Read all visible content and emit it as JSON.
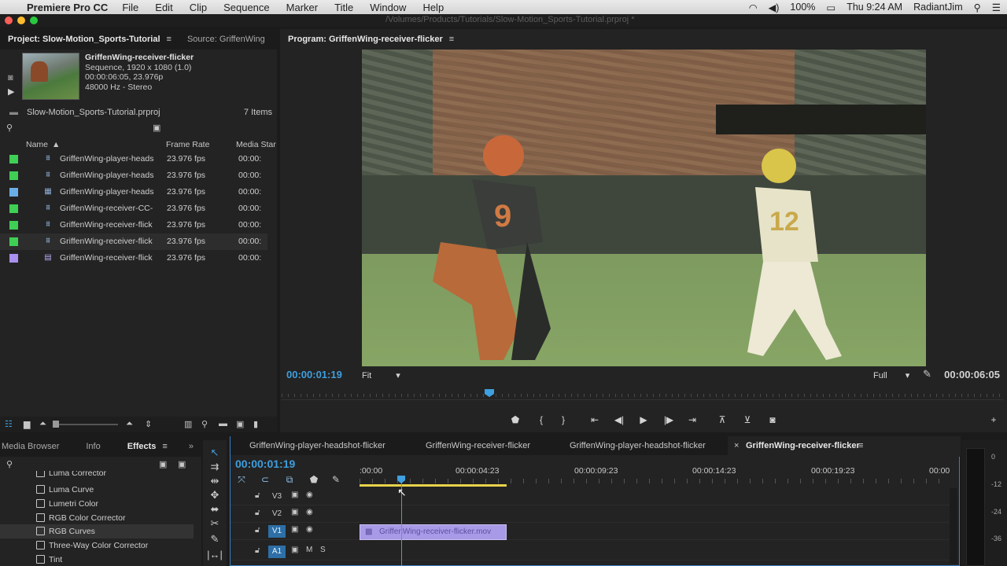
{
  "menubar": {
    "app_name": "Premiere Pro CC",
    "items": [
      "File",
      "Edit",
      "Clip",
      "Sequence",
      "Marker",
      "Title",
      "Window",
      "Help"
    ],
    "battery": "100%",
    "clock": "Thu 9:24 AM",
    "user": "RadiantJim"
  },
  "window": {
    "title_path": "/Volumes/Products/Tutorials/Slow-Motion_Sports-Tutorial.prproj *"
  },
  "project": {
    "tab_label": "Project: Slow-Motion_Sports-Tutorial",
    "source_tab_label": "Source: GriffenWing",
    "preview": {
      "name": "GriffenWing-receiver-flicker",
      "line1": "Sequence, 1920 x 1080 (1.0)",
      "line2": "00:00:06:05, 23.976p",
      "line3": "48000 Hz - Stereo"
    },
    "project_file": "Slow-Motion_Sports-Tutorial.prproj",
    "item_count": "7 Items",
    "columns": {
      "name": "Name",
      "frame_rate": "Frame Rate",
      "media_start": "Media Star"
    },
    "files": [
      {
        "name": "GriffenWing-player-heads",
        "fps": "23.976 fps",
        "start": "00:00:",
        "color": "#3fcf55",
        "icon": "sequence"
      },
      {
        "name": "GriffenWing-player-heads",
        "fps": "23.976 fps",
        "start": "00:00:",
        "color": "#3fcf55",
        "icon": "sequence"
      },
      {
        "name": "GriffenWing-player-heads",
        "fps": "23.976 fps",
        "start": "00:00:",
        "color": "#6aaee8",
        "icon": "clip"
      },
      {
        "name": "GriffenWing-receiver-CC-",
        "fps": "23.976 fps",
        "start": "00:00:",
        "color": "#3fcf55",
        "icon": "sequence"
      },
      {
        "name": "GriffenWing-receiver-flick",
        "fps": "23.976 fps",
        "start": "00:00:",
        "color": "#3fcf55",
        "icon": "sequence"
      },
      {
        "name": "GriffenWing-receiver-flick",
        "fps": "23.976 fps",
        "start": "00:00:",
        "color": "#3fcf55",
        "icon": "sequence"
      },
      {
        "name": "GriffenWing-receiver-flick",
        "fps": "23.976 fps",
        "start": "00:00:",
        "color": "#a98ff0",
        "icon": "film"
      }
    ]
  },
  "program": {
    "tab_label": "Program: GriffenWing-receiver-flicker",
    "current_tc": "00:00:01:19",
    "fit_label": "Fit",
    "quality_label": "Full",
    "duration_tc": "00:00:06:05"
  },
  "effects_panel": {
    "tabs": [
      "Media Browser",
      "Info",
      "Effects"
    ],
    "items": [
      "Luma Corrector",
      "Luma Curve",
      "Lumetri Color",
      "RGB Color Corrector",
      "RGB Curves",
      "Three-Way Color Corrector",
      "Tint"
    ],
    "selected_index": 4
  },
  "timeline": {
    "tabs": [
      "GriffenWing-player-headshot-flicker",
      "GriffenWing-receiver-flicker",
      "GriffenWing-player-headshot-flicker",
      "GriffenWing-receiver-flicker"
    ],
    "active_tab_index": 3,
    "current_tc": "00:00:01:19",
    "ruler": [
      ":00:00",
      "00:00:04:23",
      "00:00:09:23",
      "00:00:14:23",
      "00:00:19:23",
      "00:00"
    ],
    "tracks": [
      {
        "name": "V3",
        "kind": "video",
        "targeted": false
      },
      {
        "name": "V2",
        "kind": "video",
        "targeted": false
      },
      {
        "name": "V1",
        "kind": "video",
        "targeted": true
      },
      {
        "name": "A1",
        "kind": "audio",
        "targeted": true
      }
    ],
    "clip_name": "GriffenWing-receiver-flicker.mov",
    "audio_track_m": "M",
    "audio_track_s": "S"
  },
  "meters": {
    "labels": [
      "0",
      "-12",
      "-24",
      "-36"
    ]
  },
  "colors": {
    "accent": "#3ea0e0",
    "work_area": "#e8d34a",
    "clip": "#a89ae6"
  }
}
